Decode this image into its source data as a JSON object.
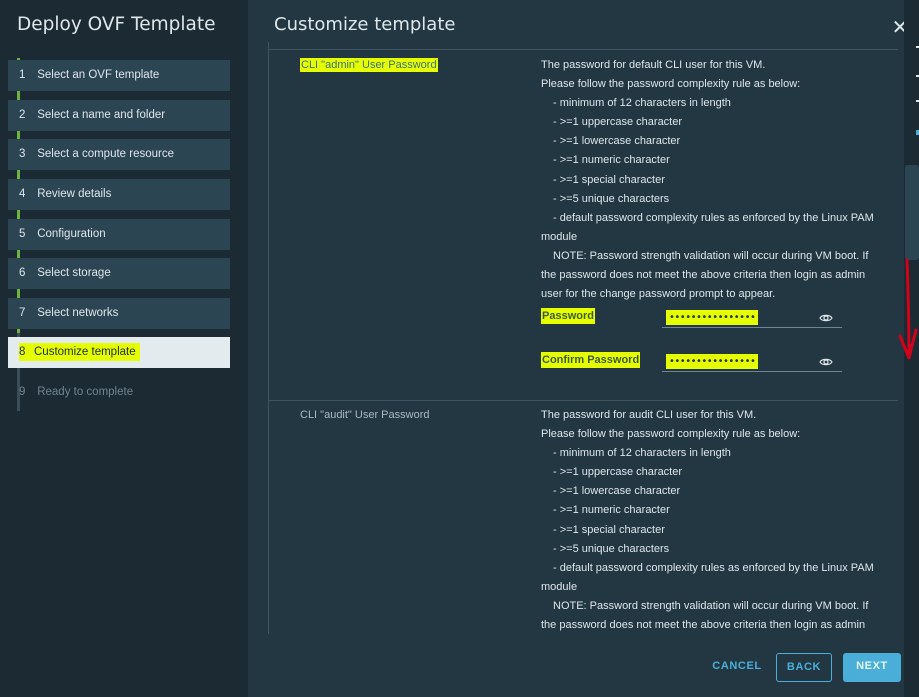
{
  "wizard": {
    "title": "Deploy OVF Template",
    "steps": [
      {
        "num": "1",
        "label": "Select an OVF template"
      },
      {
        "num": "2",
        "label": "Select a name and folder"
      },
      {
        "num": "3",
        "label": "Select a compute resource"
      },
      {
        "num": "4",
        "label": "Review details"
      },
      {
        "num": "5",
        "label": "Configuration"
      },
      {
        "num": "6",
        "label": "Select storage"
      },
      {
        "num": "7",
        "label": "Select networks"
      },
      {
        "num": "8",
        "label": "Customize template"
      },
      {
        "num": "9",
        "label": "Ready to complete"
      }
    ],
    "active_step": 8
  },
  "main": {
    "title": "Customize template",
    "close_icon": "close-icon"
  },
  "admin_section": {
    "label": "CLI \"admin\" User Password",
    "desc_lines": [
      "The password for default CLI user for this VM.",
      "Please follow the password complexity rule as below:",
      "- minimum of 12 characters in length",
      "- >=1 uppercase character",
      "- >=1 lowercase character",
      "- >=1 numeric character",
      "- >=1 special character",
      "- >=5 unique characters",
      "- default password complexity rules as enforced by the Linux PAM",
      "module",
      "NOTE: Password strength validation will occur during VM boot.  If",
      "the password does not meet the above criteria then login as admin",
      "user for the change password prompt to appear."
    ],
    "password_label": "Password",
    "password_value": "••••••••••••••••",
    "confirm_label": "Confirm Password",
    "confirm_value": "••••••••••••••••"
  },
  "audit_section": {
    "label": "CLI \"audit\" User Password",
    "desc_lines": [
      "The password for audit CLI user for this VM.",
      "Please follow the password complexity rule as below:",
      "- minimum of 12 characters in length",
      "- >=1 uppercase character",
      "- >=1 lowercase character",
      "- >=1 numeric character",
      "- >=1 special character",
      "- >=5 unique characters",
      "- default password complexity rules as enforced by the Linux PAM",
      "module",
      "NOTE: Password strength validation will occur during VM boot.  If",
      "the password does not meet the above criteria then login as admin"
    ]
  },
  "footer": {
    "cancel_label": "CANCEL",
    "back_label": "BACK",
    "next_label": "NEXT"
  },
  "colors": {
    "highlight": "#e6ff00",
    "accent": "#49afd9",
    "progress": "#6db33f",
    "annotation_arrow": "#d0021b"
  }
}
